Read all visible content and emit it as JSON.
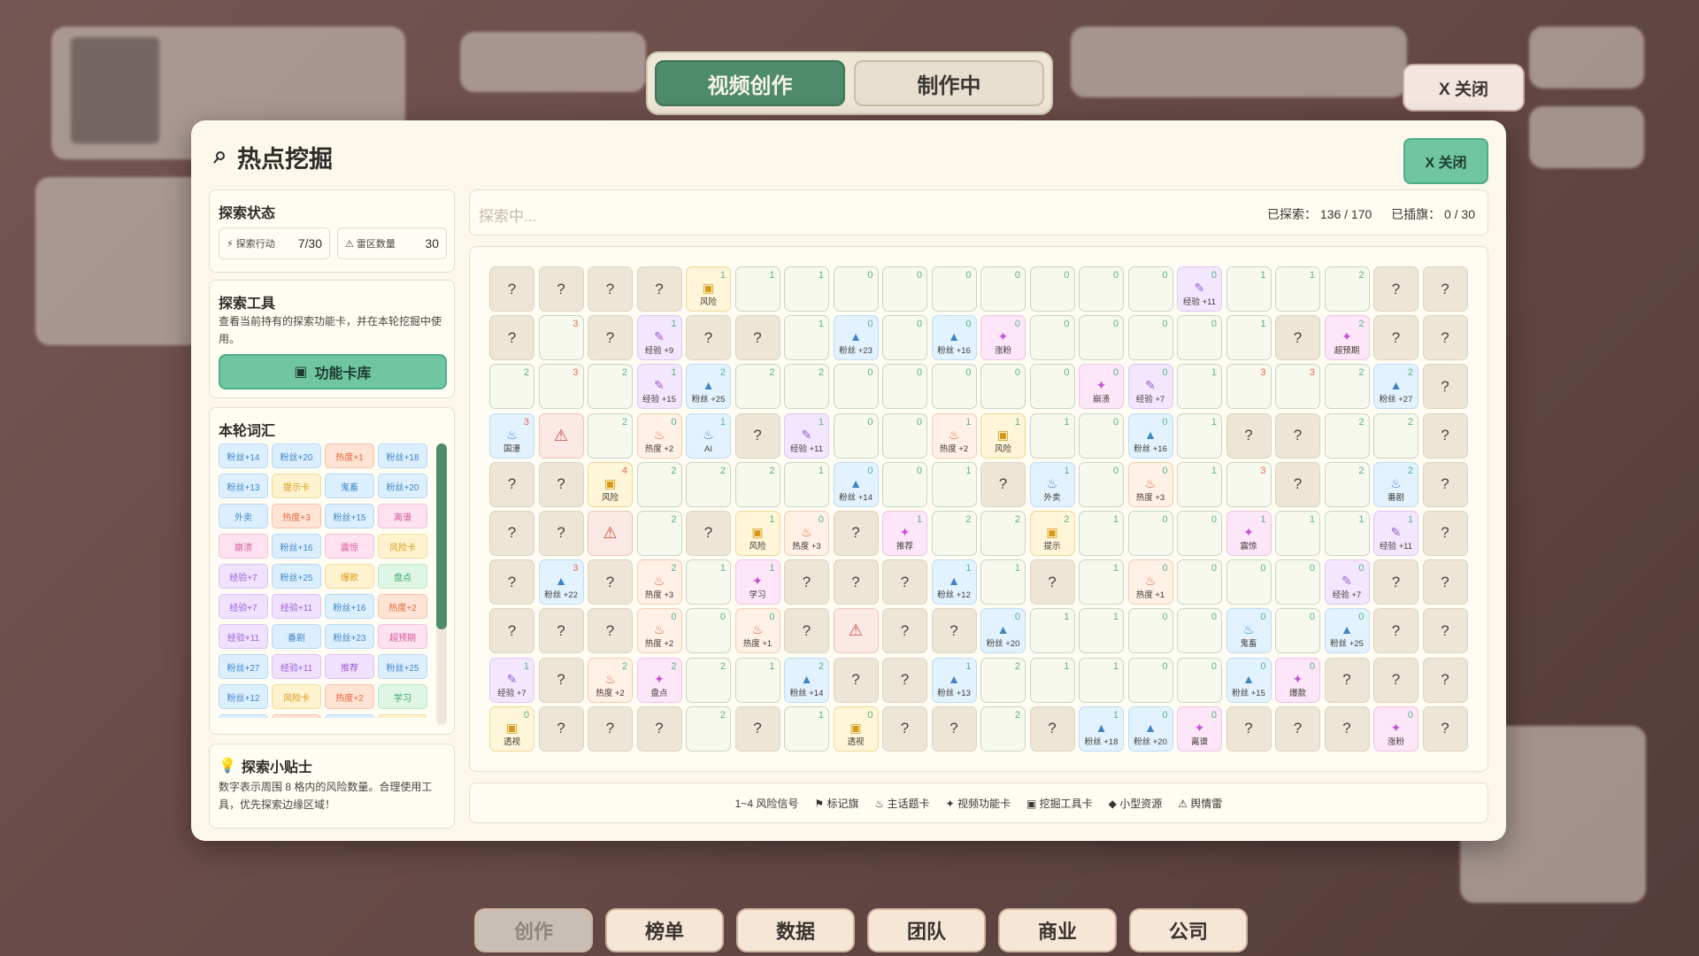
{
  "top_tabs": [
    "视频创作",
    "制作中"
  ],
  "top_close_label": "X 关闭",
  "modal": {
    "title": "热点挖掘",
    "close_label": "X 关闭"
  },
  "status_panel": {
    "title": "探索状态",
    "actions_label": "⚡ 探索行动",
    "actions_value": "7/30",
    "mines_label": "⚠ 雷区数量",
    "mines_value": "30"
  },
  "tools_panel": {
    "title": "探索工具",
    "desc": "查看当前持有的探索功能卡，并在本轮挖掘中使用。",
    "button_label": "功能卡库"
  },
  "vocab_panel": {
    "title": "本轮词汇",
    "tags": [
      {
        "t": "粉丝+14",
        "c": "blue"
      },
      {
        "t": "粉丝+20",
        "c": "blue"
      },
      {
        "t": "热度+1",
        "c": "orange"
      },
      {
        "t": "粉丝+18",
        "c": "blue"
      },
      {
        "t": "粉丝+13",
        "c": "blue"
      },
      {
        "t": "提示卡",
        "c": "yellow"
      },
      {
        "t": "鬼畜",
        "c": "blue"
      },
      {
        "t": "粉丝+20",
        "c": "blue"
      },
      {
        "t": "外卖",
        "c": "blue"
      },
      {
        "t": "热度+3",
        "c": "orange"
      },
      {
        "t": "粉丝+15",
        "c": "blue"
      },
      {
        "t": "离谱",
        "c": "pink"
      },
      {
        "t": "崩溃",
        "c": "pink"
      },
      {
        "t": "粉丝+16",
        "c": "blue"
      },
      {
        "t": "震惊",
        "c": "pink"
      },
      {
        "t": "风险卡",
        "c": "yellow"
      },
      {
        "t": "经验+7",
        "c": "purple"
      },
      {
        "t": "粉丝+25",
        "c": "blue"
      },
      {
        "t": "爆款",
        "c": "yellow"
      },
      {
        "t": "盘点",
        "c": "green"
      },
      {
        "t": "经验+7",
        "c": "purple"
      },
      {
        "t": "经验+11",
        "c": "purple"
      },
      {
        "t": "粉丝+16",
        "c": "blue"
      },
      {
        "t": "热度+2",
        "c": "orange"
      },
      {
        "t": "经验+11",
        "c": "purple"
      },
      {
        "t": "番剧",
        "c": "blue"
      },
      {
        "t": "粉丝+23",
        "c": "blue"
      },
      {
        "t": "超预期",
        "c": "pink"
      },
      {
        "t": "粉丝+27",
        "c": "blue"
      },
      {
        "t": "经验+11",
        "c": "purple"
      },
      {
        "t": "推荐",
        "c": "purple"
      },
      {
        "t": "粉丝+25",
        "c": "blue"
      },
      {
        "t": "粉丝+12",
        "c": "blue"
      },
      {
        "t": "风险卡",
        "c": "yellow"
      },
      {
        "t": "热度+2",
        "c": "orange"
      },
      {
        "t": "学习",
        "c": "green"
      },
      {
        "t": "",
        "c": "blue"
      },
      {
        "t": "",
        "c": "orange"
      },
      {
        "t": "",
        "c": "blue"
      },
      {
        "t": "",
        "c": "yellow"
      }
    ]
  },
  "tips_panel": {
    "title": "探索小贴士",
    "text": "数字表示周围 8 格内的风险数量。合理使用工具，优先探索边缘区域！"
  },
  "search": {
    "placeholder": "探索中...",
    "explored_label": "已探索：",
    "explored_value": "136 / 170",
    "flagged_label": "已插旗：",
    "flagged_value": "0 / 30"
  },
  "legend": [
    "1~4 风险信号",
    "⚑ 标记旗",
    "♨ 主话题卡",
    "✦ 视频功能卡",
    "▣ 挖掘工具卡",
    "◆ 小型资源",
    "⚠ 舆情雷"
  ],
  "bottom_nav": [
    "创作",
    "榜单",
    "数据",
    "团队",
    "商业",
    "公司"
  ],
  "kinds": {
    "blue": {
      "icon": "▲",
      "icon_name": "fans-icon"
    },
    "orange": {
      "icon": "♨",
      "icon_name": "heat-icon"
    },
    "purple": {
      "icon": "✎",
      "icon_name": "exp-icon"
    },
    "pink": {
      "icon": "✦",
      "icon_name": "sparkle-icon"
    },
    "yellow": {
      "icon": "▣",
      "icon_name": "tool-card-icon"
    },
    "bluewave": {
      "icon": "♨",
      "icon_name": "topic-icon"
    },
    "warn": {
      "icon": "⚠",
      "icon_name": "mine-icon"
    }
  },
  "grid": [
    [
      {
        "u": 1
      },
      {
        "u": 1
      },
      {
        "u": 1
      },
      {
        "u": 1
      },
      {
        "n": 1,
        "k": "yellow",
        "l": "风险"
      },
      {
        "n": 1
      },
      {
        "n": 1
      },
      {
        "n": 0
      },
      {
        "n": 0
      },
      {
        "n": 0
      },
      {
        "n": 0
      },
      {
        "n": 0
      },
      {
        "n": 0
      },
      {
        "n": 0
      },
      {
        "n": 0,
        "k": "purple",
        "l": "经验 +11"
      },
      {
        "n": 1
      },
      {
        "n": 1
      },
      {
        "n": 2
      },
      {
        "u": 1
      },
      {
        "u": 1
      }
    ],
    [
      {
        "u": 1
      },
      {
        "n": 3
      },
      {
        "u": 1
      },
      {
        "n": 1,
        "k": "purple",
        "l": "经验 +9"
      },
      {
        "u": 1
      },
      {
        "u": 1
      },
      {
        "n": 1
      },
      {
        "n": 0,
        "k": "blue",
        "l": "粉丝 +23"
      },
      {
        "n": 0
      },
      {
        "n": 0,
        "k": "blue",
        "l": "粉丝 +16"
      },
      {
        "n": 0,
        "k": "pink",
        "l": "涨粉"
      },
      {
        "n": 0
      },
      {
        "n": 0
      },
      {
        "n": 0
      },
      {
        "n": 0
      },
      {
        "n": 1
      },
      {
        "u": 1
      },
      {
        "n": 2,
        "k": "pink",
        "l": "超预期"
      },
      {
        "u": 1
      },
      {
        "u": 1
      }
    ],
    [
      {
        "n": 2
      },
      {
        "n": 3
      },
      {
        "n": 2
      },
      {
        "n": 1,
        "k": "purple",
        "l": "经验 +15"
      },
      {
        "n": 2,
        "k": "blue",
        "l": "粉丝 +25"
      },
      {
        "n": 2
      },
      {
        "n": 2
      },
      {
        "n": 0
      },
      {
        "n": 0
      },
      {
        "n": 0
      },
      {
        "n": 0
      },
      {
        "n": 0
      },
      {
        "n": 0,
        "k": "pink",
        "l": "崩溃"
      },
      {
        "n": 0,
        "k": "purple",
        "l": "经验 +7"
      },
      {
        "n": 1
      },
      {
        "n": 3
      },
      {
        "n": 3
      },
      {
        "n": 2
      },
      {
        "n": 2,
        "k": "blue",
        "l": "粉丝 +27"
      },
      {
        "u": 1
      }
    ],
    [
      {
        "n": 3,
        "k": "bluewave",
        "l": "国漫"
      },
      {
        "k": "warn"
      },
      {
        "n": 2
      },
      {
        "n": 0,
        "k": "orange",
        "l": "热度 +2"
      },
      {
        "n": 1,
        "k": "bluewave",
        "l": "AI"
      },
      {
        "u": 1
      },
      {
        "n": 1,
        "k": "purple",
        "l": "经验 +11"
      },
      {
        "n": 0
      },
      {
        "n": 0
      },
      {
        "n": 1,
        "k": "orange",
        "l": "热度 +2"
      },
      {
        "n": 1,
        "k": "yellow",
        "l": "风险"
      },
      {
        "n": 1
      },
      {
        "n": 0
      },
      {
        "n": 0,
        "k": "blue",
        "l": "粉丝 +16"
      },
      {
        "n": 1
      },
      {
        "u": 1
      },
      {
        "u": 1
      },
      {
        "n": 2
      },
      {
        "n": 2
      },
      {
        "u": 1
      }
    ],
    [
      {
        "u": 1
      },
      {
        "u": 1
      },
      {
        "n": 4,
        "k": "yellow",
        "l": "风险"
      },
      {
        "n": 2
      },
      {
        "n": 2
      },
      {
        "n": 2
      },
      {
        "n": 1
      },
      {
        "n": 0,
        "k": "blue",
        "l": "粉丝 +14"
      },
      {
        "n": 0
      },
      {
        "n": 1
      },
      {
        "u": 1
      },
      {
        "n": 1,
        "k": "bluewave",
        "l": "外卖"
      },
      {
        "n": 0
      },
      {
        "n": 0,
        "k": "orange",
        "l": "热度 +3"
      },
      {
        "n": 1
      },
      {
        "n": 3
      },
      {
        "u": 1
      },
      {
        "n": 2
      },
      {
        "n": 2,
        "k": "bluewave",
        "l": "番剧"
      },
      {
        "u": 1
      }
    ],
    [
      {
        "u": 1
      },
      {
        "u": 1
      },
      {
        "k": "warn"
      },
      {
        "n": 2
      },
      {
        "u": 1
      },
      {
        "n": 1,
        "k": "yellow",
        "l": "风险"
      },
      {
        "n": 0,
        "k": "orange",
        "l": "热度 +3"
      },
      {
        "u": 1
      },
      {
        "n": 1,
        "k": "pink",
        "l": "推荐"
      },
      {
        "n": 2
      },
      {
        "n": 2
      },
      {
        "n": 2,
        "k": "yellow",
        "l": "提示"
      },
      {
        "n": 1
      },
      {
        "n": 0
      },
      {
        "n": 0
      },
      {
        "n": 1,
        "k": "pink",
        "l": "震惊"
      },
      {
        "n": 1
      },
      {
        "n": 1
      },
      {
        "n": 1,
        "k": "purple",
        "l": "经验 +11"
      },
      {
        "u": 1
      }
    ],
    [
      {
        "u": 1
      },
      {
        "n": 3,
        "k": "blue",
        "l": "粉丝 +22"
      },
      {
        "u": 1
      },
      {
        "n": 2,
        "k": "orange",
        "l": "热度 +3"
      },
      {
        "n": 1
      },
      {
        "n": 1,
        "k": "pink",
        "l": "学习"
      },
      {
        "u": 1
      },
      {
        "u": 1
      },
      {
        "u": 1
      },
      {
        "n": 1,
        "k": "blue",
        "l": "粉丝 +12"
      },
      {
        "n": 1
      },
      {
        "u": 1
      },
      {
        "n": 1
      },
      {
        "n": 0,
        "k": "orange",
        "l": "热度 +1"
      },
      {
        "n": 0
      },
      {
        "n": 0
      },
      {
        "n": 0
      },
      {
        "n": 0,
        "k": "purple",
        "l": "经验 +7"
      },
      {
        "u": 1
      },
      {
        "u": 1
      }
    ],
    [
      {
        "u": 1
      },
      {
        "u": 1
      },
      {
        "u": 1
      },
      {
        "n": 0,
        "k": "orange",
        "l": "热度 +2"
      },
      {
        "n": 0
      },
      {
        "n": 0,
        "k": "orange",
        "l": "热度 +1"
      },
      {
        "u": 1
      },
      {
        "k": "warn"
      },
      {
        "u": 1
      },
      {
        "u": 1
      },
      {
        "n": 0,
        "k": "blue",
        "l": "粉丝 +20"
      },
      {
        "n": 1
      },
      {
        "n": 1
      },
      {
        "n": 0
      },
      {
        "n": 0
      },
      {
        "n": 0,
        "k": "bluewave",
        "l": "鬼畜"
      },
      {
        "n": 0
      },
      {
        "n": 0,
        "k": "blue",
        "l": "粉丝 +25"
      },
      {
        "u": 1
      },
      {
        "u": 1
      }
    ],
    [
      {
        "n": 1,
        "k": "purple",
        "l": "经验 +7"
      },
      {
        "u": 1
      },
      {
        "n": 2,
        "k": "orange",
        "l": "热度 +2"
      },
      {
        "n": 2,
        "k": "pink",
        "l": "盘点"
      },
      {
        "n": 2
      },
      {
        "n": 1
      },
      {
        "n": 2,
        "k": "blue",
        "l": "粉丝 +14"
      },
      {
        "u": 1
      },
      {
        "u": 1
      },
      {
        "n": 1,
        "k": "blue",
        "l": "粉丝 +13"
      },
      {
        "n": 2
      },
      {
        "n": 1
      },
      {
        "n": 1
      },
      {
        "n": 0
      },
      {
        "n": 0
      },
      {
        "n": 0,
        "k": "blue",
        "l": "粉丝 +15"
      },
      {
        "n": 0,
        "k": "pink",
        "l": "爆款"
      },
      {
        "u": 1
      },
      {
        "u": 1
      },
      {
        "u": 1
      }
    ],
    [
      {
        "n": 0,
        "k": "yellow",
        "l": "透视"
      },
      {
        "u": 1
      },
      {
        "u": 1
      },
      {
        "u": 1
      },
      {
        "n": 2
      },
      {
        "u": 1
      },
      {
        "n": 1
      },
      {
        "n": 0,
        "k": "yellow",
        "l": "透视"
      },
      {
        "u": 1
      },
      {
        "u": 1
      },
      {
        "n": 2
      },
      {
        "u": 1
      },
      {
        "n": 1,
        "k": "blue",
        "l": "粉丝 +18"
      },
      {
        "n": 0,
        "k": "blue",
        "l": "粉丝 +20"
      },
      {
        "n": 0,
        "k": "pink",
        "l": "离谱"
      },
      {
        "u": 1
      },
      {
        "u": 1
      },
      {
        "u": 1
      },
      {
        "n": 0,
        "k": "pink",
        "l": "涨粉"
      },
      {
        "u": 1
      }
    ]
  ]
}
